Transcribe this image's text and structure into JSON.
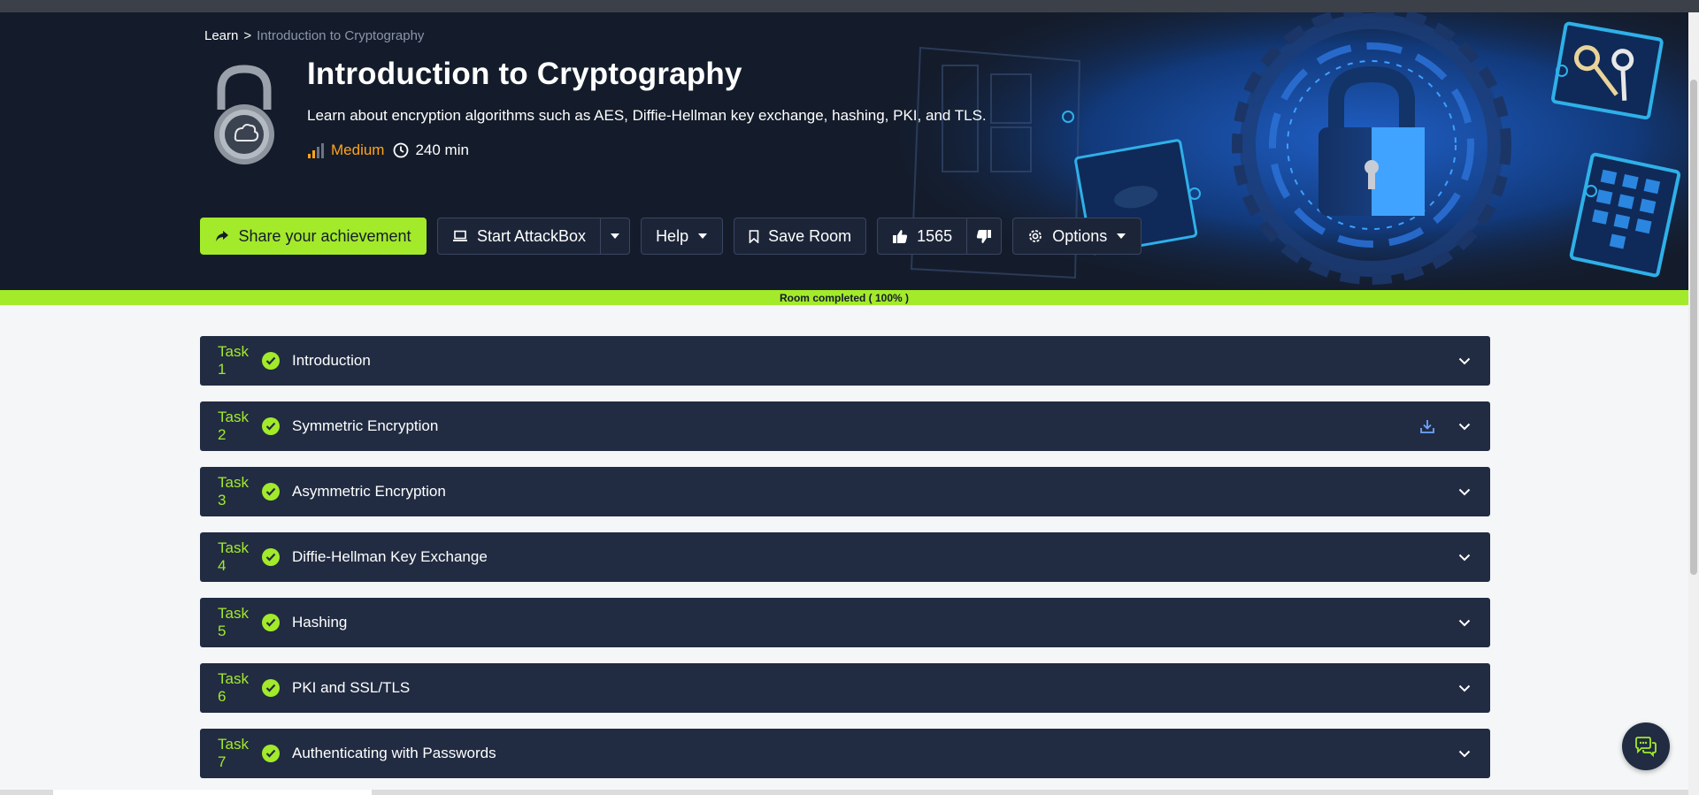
{
  "breadcrumb": {
    "root": "Learn",
    "separator": ">",
    "current": "Introduction to Cryptography"
  },
  "room": {
    "title": "Introduction to Cryptography",
    "description": "Learn about encryption algorithms such as AES, Diffie-Hellman key exchange, hashing, PKI, and TLS.",
    "difficulty": "Medium",
    "duration": "240 min"
  },
  "actions": {
    "share": "Share your achievement",
    "attackbox": "Start AttackBox",
    "help": "Help",
    "save": "Save Room",
    "likes": "1565",
    "options": "Options"
  },
  "progress": {
    "label": "Room completed ( 100% )",
    "percent": 100
  },
  "tasks": [
    {
      "num": "Task 1",
      "title": "Introduction",
      "download": false
    },
    {
      "num": "Task 2",
      "title": "Symmetric Encryption",
      "download": true
    },
    {
      "num": "Task 3",
      "title": "Asymmetric Encryption",
      "download": false
    },
    {
      "num": "Task 4",
      "title": "Diffie-Hellman Key Exchange",
      "download": false
    },
    {
      "num": "Task 5",
      "title": "Hashing",
      "download": false
    },
    {
      "num": "Task 6",
      "title": "PKI and SSL/TLS",
      "download": false
    },
    {
      "num": "Task 7",
      "title": "Authenticating with Passwords",
      "download": false
    }
  ],
  "colors": {
    "accent": "#a3ea2a",
    "hero_bg": "#141c2b",
    "task_bg": "#212c42",
    "difficulty": "#ffa41a"
  },
  "icons": {
    "share": "share-arrow-icon",
    "attackbox": "laptop-icon",
    "save": "bookmark-icon",
    "like": "thumbs-up-icon",
    "dislike": "thumbs-down-icon",
    "options": "gear-icon",
    "duration": "clock-icon",
    "difficulty": "signal-bars-icon",
    "task_done": "check-circle-icon",
    "expand": "chevron-down-icon",
    "download": "download-icon",
    "chat": "chat-icon"
  }
}
